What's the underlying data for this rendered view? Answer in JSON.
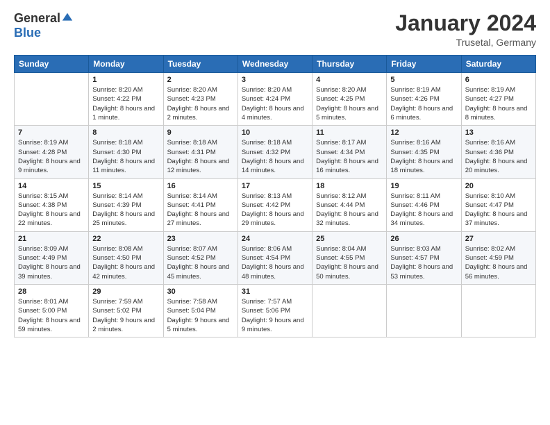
{
  "logo": {
    "general": "General",
    "blue": "Blue"
  },
  "title": "January 2024",
  "subtitle": "Trusetal, Germany",
  "days_of_week": [
    "Sunday",
    "Monday",
    "Tuesday",
    "Wednesday",
    "Thursday",
    "Friday",
    "Saturday"
  ],
  "weeks": [
    [
      {
        "day": "",
        "sunrise": "",
        "sunset": "",
        "daylight": ""
      },
      {
        "day": "1",
        "sunrise": "Sunrise: 8:20 AM",
        "sunset": "Sunset: 4:22 PM",
        "daylight": "Daylight: 8 hours and 1 minute."
      },
      {
        "day": "2",
        "sunrise": "Sunrise: 8:20 AM",
        "sunset": "Sunset: 4:23 PM",
        "daylight": "Daylight: 8 hours and 2 minutes."
      },
      {
        "day": "3",
        "sunrise": "Sunrise: 8:20 AM",
        "sunset": "Sunset: 4:24 PM",
        "daylight": "Daylight: 8 hours and 4 minutes."
      },
      {
        "day": "4",
        "sunrise": "Sunrise: 8:20 AM",
        "sunset": "Sunset: 4:25 PM",
        "daylight": "Daylight: 8 hours and 5 minutes."
      },
      {
        "day": "5",
        "sunrise": "Sunrise: 8:19 AM",
        "sunset": "Sunset: 4:26 PM",
        "daylight": "Daylight: 8 hours and 6 minutes."
      },
      {
        "day": "6",
        "sunrise": "Sunrise: 8:19 AM",
        "sunset": "Sunset: 4:27 PM",
        "daylight": "Daylight: 8 hours and 8 minutes."
      }
    ],
    [
      {
        "day": "7",
        "sunrise": "Sunrise: 8:19 AM",
        "sunset": "Sunset: 4:28 PM",
        "daylight": "Daylight: 8 hours and 9 minutes."
      },
      {
        "day": "8",
        "sunrise": "Sunrise: 8:18 AM",
        "sunset": "Sunset: 4:30 PM",
        "daylight": "Daylight: 8 hours and 11 minutes."
      },
      {
        "day": "9",
        "sunrise": "Sunrise: 8:18 AM",
        "sunset": "Sunset: 4:31 PM",
        "daylight": "Daylight: 8 hours and 12 minutes."
      },
      {
        "day": "10",
        "sunrise": "Sunrise: 8:18 AM",
        "sunset": "Sunset: 4:32 PM",
        "daylight": "Daylight: 8 hours and 14 minutes."
      },
      {
        "day": "11",
        "sunrise": "Sunrise: 8:17 AM",
        "sunset": "Sunset: 4:34 PM",
        "daylight": "Daylight: 8 hours and 16 minutes."
      },
      {
        "day": "12",
        "sunrise": "Sunrise: 8:16 AM",
        "sunset": "Sunset: 4:35 PM",
        "daylight": "Daylight: 8 hours and 18 minutes."
      },
      {
        "day": "13",
        "sunrise": "Sunrise: 8:16 AM",
        "sunset": "Sunset: 4:36 PM",
        "daylight": "Daylight: 8 hours and 20 minutes."
      }
    ],
    [
      {
        "day": "14",
        "sunrise": "Sunrise: 8:15 AM",
        "sunset": "Sunset: 4:38 PM",
        "daylight": "Daylight: 8 hours and 22 minutes."
      },
      {
        "day": "15",
        "sunrise": "Sunrise: 8:14 AM",
        "sunset": "Sunset: 4:39 PM",
        "daylight": "Daylight: 8 hours and 25 minutes."
      },
      {
        "day": "16",
        "sunrise": "Sunrise: 8:14 AM",
        "sunset": "Sunset: 4:41 PM",
        "daylight": "Daylight: 8 hours and 27 minutes."
      },
      {
        "day": "17",
        "sunrise": "Sunrise: 8:13 AM",
        "sunset": "Sunset: 4:42 PM",
        "daylight": "Daylight: 8 hours and 29 minutes."
      },
      {
        "day": "18",
        "sunrise": "Sunrise: 8:12 AM",
        "sunset": "Sunset: 4:44 PM",
        "daylight": "Daylight: 8 hours and 32 minutes."
      },
      {
        "day": "19",
        "sunrise": "Sunrise: 8:11 AM",
        "sunset": "Sunset: 4:46 PM",
        "daylight": "Daylight: 8 hours and 34 minutes."
      },
      {
        "day": "20",
        "sunrise": "Sunrise: 8:10 AM",
        "sunset": "Sunset: 4:47 PM",
        "daylight": "Daylight: 8 hours and 37 minutes."
      }
    ],
    [
      {
        "day": "21",
        "sunrise": "Sunrise: 8:09 AM",
        "sunset": "Sunset: 4:49 PM",
        "daylight": "Daylight: 8 hours and 39 minutes."
      },
      {
        "day": "22",
        "sunrise": "Sunrise: 8:08 AM",
        "sunset": "Sunset: 4:50 PM",
        "daylight": "Daylight: 8 hours and 42 minutes."
      },
      {
        "day": "23",
        "sunrise": "Sunrise: 8:07 AM",
        "sunset": "Sunset: 4:52 PM",
        "daylight": "Daylight: 8 hours and 45 minutes."
      },
      {
        "day": "24",
        "sunrise": "Sunrise: 8:06 AM",
        "sunset": "Sunset: 4:54 PM",
        "daylight": "Daylight: 8 hours and 48 minutes."
      },
      {
        "day": "25",
        "sunrise": "Sunrise: 8:04 AM",
        "sunset": "Sunset: 4:55 PM",
        "daylight": "Daylight: 8 hours and 50 minutes."
      },
      {
        "day": "26",
        "sunrise": "Sunrise: 8:03 AM",
        "sunset": "Sunset: 4:57 PM",
        "daylight": "Daylight: 8 hours and 53 minutes."
      },
      {
        "day": "27",
        "sunrise": "Sunrise: 8:02 AM",
        "sunset": "Sunset: 4:59 PM",
        "daylight": "Daylight: 8 hours and 56 minutes."
      }
    ],
    [
      {
        "day": "28",
        "sunrise": "Sunrise: 8:01 AM",
        "sunset": "Sunset: 5:00 PM",
        "daylight": "Daylight: 8 hours and 59 minutes."
      },
      {
        "day": "29",
        "sunrise": "Sunrise: 7:59 AM",
        "sunset": "Sunset: 5:02 PM",
        "daylight": "Daylight: 9 hours and 2 minutes."
      },
      {
        "day": "30",
        "sunrise": "Sunrise: 7:58 AM",
        "sunset": "Sunset: 5:04 PM",
        "daylight": "Daylight: 9 hours and 5 minutes."
      },
      {
        "day": "31",
        "sunrise": "Sunrise: 7:57 AM",
        "sunset": "Sunset: 5:06 PM",
        "daylight": "Daylight: 9 hours and 9 minutes."
      },
      {
        "day": "",
        "sunrise": "",
        "sunset": "",
        "daylight": ""
      },
      {
        "day": "",
        "sunrise": "",
        "sunset": "",
        "daylight": ""
      },
      {
        "day": "",
        "sunrise": "",
        "sunset": "",
        "daylight": ""
      }
    ]
  ]
}
